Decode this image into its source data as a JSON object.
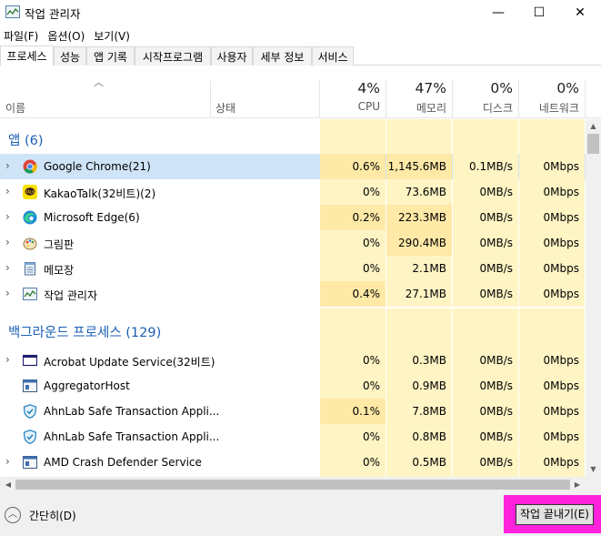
{
  "window": {
    "title": "작업 관리자",
    "minimize_glyph": "—",
    "maximize_glyph": "☐",
    "close_glyph": "✕"
  },
  "menu": [
    "파일(F)",
    "옵션(O)",
    "보기(V)"
  ],
  "tabs": [
    "프로세스",
    "성능",
    "앱 기록",
    "시작프로그램",
    "사용자",
    "세부 정보",
    "서비스"
  ],
  "active_tab": "프로세스",
  "columns": {
    "name": "이름",
    "status": "상태",
    "cpu": {
      "pct": "4%",
      "label": "CPU"
    },
    "memory": {
      "pct": "47%",
      "label": "메모리"
    },
    "disk": {
      "pct": "0%",
      "label": "디스크"
    },
    "network": {
      "pct": "0%",
      "label": "네트워크"
    }
  },
  "groups": [
    {
      "title": "앱 (6)",
      "rows": [
        {
          "name": "Google Chrome(21)",
          "icon": "chrome-icon",
          "expandable": true,
          "selected": true,
          "cpu": "0.6%",
          "mem": "1,145.6MB",
          "disk": "0.1MB/s",
          "net": "0Mbps"
        },
        {
          "name": "KakaoTalk(32비트)(2)",
          "icon": "kakaotalk-icon",
          "expandable": true,
          "selected": false,
          "cpu": "0%",
          "mem": "73.6MB",
          "disk": "0MB/s",
          "net": "0Mbps"
        },
        {
          "name": "Microsoft Edge(6)",
          "icon": "edge-icon",
          "expandable": true,
          "selected": false,
          "cpu": "0.2%",
          "mem": "223.3MB",
          "disk": "0MB/s",
          "net": "0Mbps"
        },
        {
          "name": "그림판",
          "icon": "paint-icon",
          "expandable": true,
          "selected": false,
          "cpu": "0%",
          "mem": "290.4MB",
          "disk": "0MB/s",
          "net": "0Mbps"
        },
        {
          "name": "메모장",
          "icon": "notepad-icon",
          "expandable": true,
          "selected": false,
          "cpu": "0%",
          "mem": "2.1MB",
          "disk": "0MB/s",
          "net": "0Mbps"
        },
        {
          "name": "작업 관리자",
          "icon": "task-manager-icon",
          "expandable": true,
          "selected": false,
          "cpu": "0.4%",
          "mem": "27.1MB",
          "disk": "0MB/s",
          "net": "0Mbps"
        }
      ]
    },
    {
      "title": "백그라운드 프로세스 (129)",
      "rows": [
        {
          "name": "Acrobat Update Service(32비트)",
          "icon": "window-icon",
          "expandable": true,
          "selected": false,
          "cpu": "0%",
          "mem": "0.3MB",
          "disk": "0MB/s",
          "net": "0Mbps"
        },
        {
          "name": "AggregatorHost",
          "icon": "service-icon",
          "expandable": false,
          "selected": false,
          "cpu": "0%",
          "mem": "0.9MB",
          "disk": "0MB/s",
          "net": "0Mbps"
        },
        {
          "name": "AhnLab Safe Transaction Appli...",
          "icon": "ahnlab-shield-icon",
          "expandable": false,
          "selected": false,
          "cpu": "0.1%",
          "mem": "7.8MB",
          "disk": "0MB/s",
          "net": "0Mbps"
        },
        {
          "name": "AhnLab Safe Transaction Appli...",
          "icon": "ahnlab-shield-icon",
          "expandable": false,
          "selected": false,
          "cpu": "0%",
          "mem": "0.8MB",
          "disk": "0MB/s",
          "net": "0Mbps"
        },
        {
          "name": "AMD Crash Defender Service",
          "icon": "service-icon",
          "expandable": true,
          "selected": false,
          "cpu": "0%",
          "mem": "0.5MB",
          "disk": "0MB/s",
          "net": "0Mbps"
        }
      ]
    }
  ],
  "footer": {
    "collapse_label": "간단히(D)",
    "end_task_label": "작업 끝내기(E)"
  },
  "colors": {
    "group_title": "#1b5fb4",
    "heat_light": "#fff4c4",
    "heat_med": "#ffe9a6",
    "selected": "#cfe4f6",
    "highlight": "#ff22dd"
  }
}
